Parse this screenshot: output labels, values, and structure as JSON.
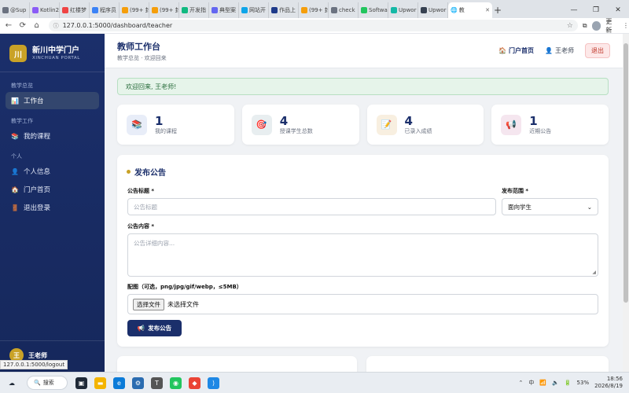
{
  "browser": {
    "tabs": [
      {
        "label": "@Sup",
        "color": "#6b7280"
      },
      {
        "label": "Kotlin2",
        "color": "#8b5cf6"
      },
      {
        "label": "红楼梦",
        "color": "#ef4444"
      },
      {
        "label": "程序员",
        "color": "#3b82f6"
      },
      {
        "label": "(99+ 封",
        "color": "#f59e0b"
      },
      {
        "label": "(99+ 封",
        "color": "#f59e0b"
      },
      {
        "label": "开发指",
        "color": "#10b981"
      },
      {
        "label": "典型案",
        "color": "#6366f1"
      },
      {
        "label": "网站开",
        "color": "#0ea5e9"
      },
      {
        "label": "作品上",
        "color": "#1e3a8a"
      },
      {
        "label": "(99+ 封",
        "color": "#f59e0b"
      },
      {
        "label": "check",
        "color": "#6b7280"
      },
      {
        "label": "Softwa",
        "color": "#22c55e"
      },
      {
        "label": "Upwor",
        "color": "#14b8a6"
      },
      {
        "label": "Upwor",
        "color": "#374151"
      }
    ],
    "active_tab": "教",
    "url": "127.0.0.1:5000/dashboard/teacher",
    "update_label": "更新",
    "status_url": "127.0.0.1:5000/logout"
  },
  "sidebar": {
    "logo": "川",
    "name": "新川中学门户",
    "name_en": "XINCHUAN PORTAL",
    "sections": [
      {
        "title": "教学总览",
        "items": [
          {
            "label": "工作台",
            "icon": "📊",
            "active": true
          }
        ]
      },
      {
        "title": "教学工作",
        "items": [
          {
            "label": "我的课程",
            "icon": "📚",
            "active": false
          }
        ]
      },
      {
        "title": "个人",
        "items": [
          {
            "label": "个人信息",
            "icon": "👤",
            "active": false
          },
          {
            "label": "门户首页",
            "icon": "🏠",
            "active": false
          },
          {
            "label": "退出登录",
            "icon": "🚪",
            "active": false
          }
        ]
      }
    ],
    "user_avatar": "王",
    "user_name": "王老师"
  },
  "header": {
    "title": "教师工作台",
    "subtitle": "教学总览 · 欢迎回来",
    "portal_link": "门户首页",
    "user": "王老师",
    "logout": "退出"
  },
  "alert": "欢迎回来, 王老师!",
  "stats": [
    {
      "value": "1",
      "label": "我的课程",
      "icon": "📚",
      "bg": "#e8edf8"
    },
    {
      "value": "4",
      "label": "授课学生总数",
      "icon": "🎯",
      "bg": "#e8eef0"
    },
    {
      "value": "4",
      "label": "已录入成绩",
      "icon": "📝",
      "bg": "#f8efe0"
    },
    {
      "value": "1",
      "label": "近期公告",
      "icon": "📢",
      "bg": "#f5e6ef"
    }
  ],
  "form": {
    "title": "发布公告",
    "title_label": "公告标题 *",
    "title_placeholder": "公告标题",
    "scope_label": "发布范围 *",
    "scope_value": "面向学生",
    "content_label": "公告内容 *",
    "content_placeholder": "公告详细内容...",
    "image_label": "配图（可选，png/jpg/gif/webp，≤5MB）",
    "file_button": "选择文件",
    "file_status": "未选择文件",
    "submit": "发布公告"
  },
  "taskbar": {
    "search": "搜索",
    "ime": "中",
    "battery": "53%",
    "time": "18:56",
    "date": "2026/8/19"
  }
}
